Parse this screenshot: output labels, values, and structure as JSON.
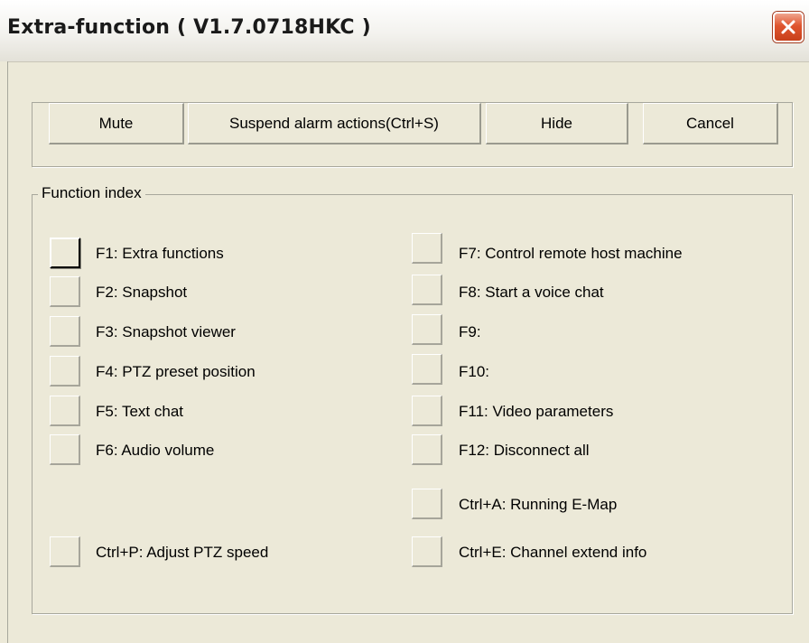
{
  "window": {
    "title": "Extra-function ( V1.7.0718HKC )",
    "close_icon": "close-icon"
  },
  "toolbar": {
    "mute_label": "Mute",
    "suspend_label": "Suspend alarm actions(Ctrl+S)",
    "hide_label": "Hide",
    "cancel_label": "Cancel"
  },
  "function_index": {
    "legend": "Function index",
    "left": [
      "F1: Extra functions",
      "F2: Snapshot",
      "F3: Snapshot viewer",
      "F4: PTZ preset position",
      "F5: Text chat",
      "F6: Audio volume",
      "Ctrl+P: Adjust PTZ speed"
    ],
    "right": [
      "F7: Control remote host machine",
      "F8: Start a voice chat",
      "F9:",
      "F10:",
      "F11: Video parameters",
      "F12: Disconnect all",
      "Ctrl+A: Running E-Map",
      "Ctrl+E: Channel extend info"
    ]
  },
  "colors": {
    "face": "#ece9d8",
    "close_button": "#e0552f"
  }
}
